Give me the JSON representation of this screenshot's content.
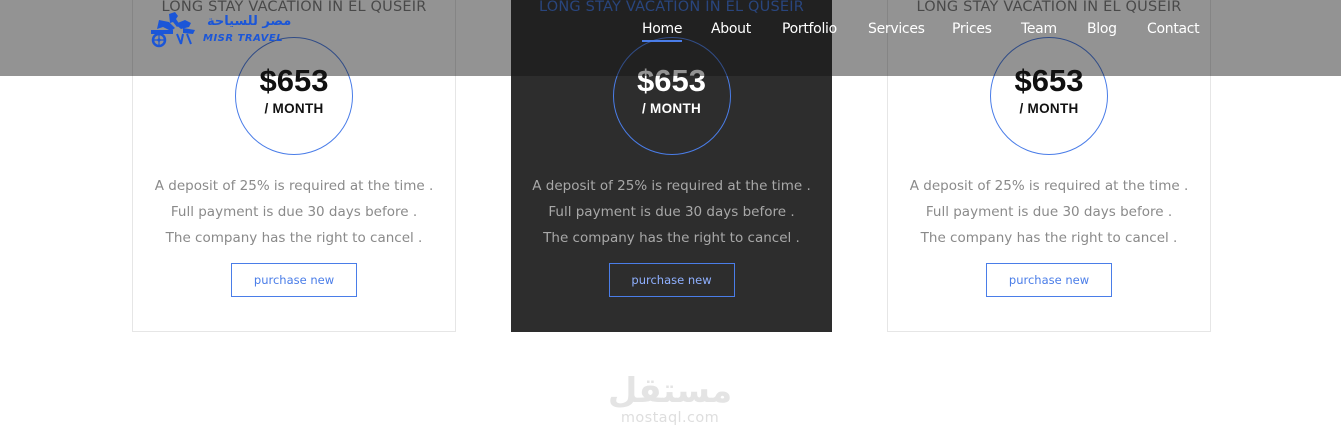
{
  "brand": {
    "name_arabic": "مصر للسياحة",
    "name_latin": "MISR TRAVEL",
    "color": "#1b56d8"
  },
  "nav": {
    "items": [
      {
        "label": "Home",
        "active": true
      },
      {
        "label": "About",
        "active": false
      },
      {
        "label": "Portfolio",
        "active": false
      },
      {
        "label": "Services",
        "active": false
      },
      {
        "label": "Prices",
        "active": false
      },
      {
        "label": "Team",
        "active": false
      },
      {
        "label": "Blog",
        "active": false
      },
      {
        "label": "Contact",
        "active": false
      }
    ]
  },
  "pricing": {
    "cards": [
      {
        "title": "LONG STAY VACATION IN EL QUSEIR",
        "price": "$653",
        "period": "/ MONTH",
        "terms": [
          "A deposit of 25% is required at the time .",
          "Full payment is due 30 days before .",
          "The company has the right to cancel ."
        ],
        "button_label": "purchase new",
        "highlighted": false
      },
      {
        "title": "LONG STAY VACATION IN EL QUSEIR",
        "price": "$653",
        "period": "/ MONTH",
        "terms": [
          "A deposit of 25% is required at the time .",
          "Full payment is due 30 days before .",
          "The company has the right to cancel ."
        ],
        "button_label": "purchase new",
        "highlighted": true
      },
      {
        "title": "LONG STAY VACATION IN EL QUSEIR",
        "price": "$653",
        "period": "/ MONTH",
        "terms": [
          "A deposit of 25% is required at the time .",
          "Full payment is due 30 days before .",
          "The company has the right to cancel ."
        ],
        "button_label": "purchase new",
        "highlighted": false
      }
    ]
  },
  "watermark": {
    "arabic": "مستقل",
    "latin": "mostaql.com"
  },
  "colors": {
    "accent": "#4a7de8",
    "highlight_card_bg": "#2d2d2d",
    "header_overlay": "rgba(20,20,20,0.46)"
  }
}
